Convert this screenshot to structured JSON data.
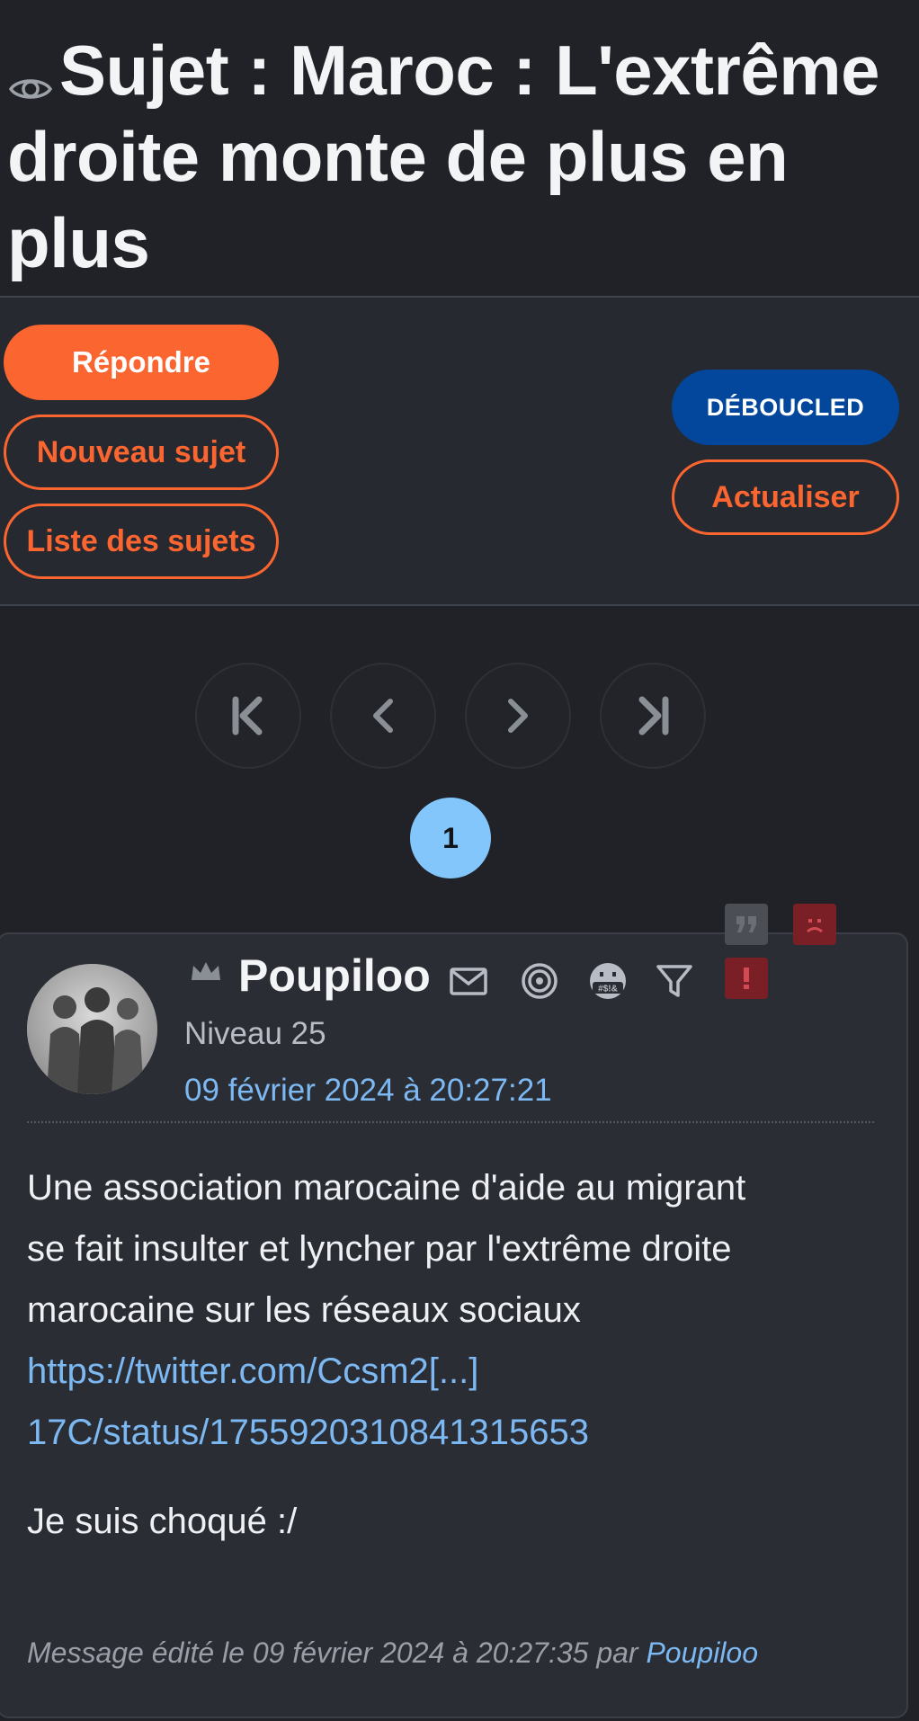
{
  "topic": {
    "title_line1": "Sujet : Maroc : L'extrême",
    "title_line2": "droite monte de plus en plus"
  },
  "actions": {
    "reply_label": "Répondre",
    "new_topic_label": "Nouveau sujet",
    "topic_list_label": "Liste des sujets",
    "deboucled_label": "DÉBOUCLED",
    "refresh_label": "Actualiser"
  },
  "pagination": {
    "current_page": "1",
    "icons": [
      "first-page-icon",
      "prev-page-icon",
      "next-page-icon",
      "last-page-icon"
    ]
  },
  "post": {
    "author": "Poupiloo",
    "level": "Niveau 25",
    "date": "09 février 2024 à 20:27:21",
    "body_lines": [
      "Une association marocaine d'aide au migrant",
      "se fait insulter et lyncher par l'extrême droite",
      "marocaine sur les réseaux sociaux"
    ],
    "link_line1": "https://twitter.com/Ccsm2[...]",
    "link_line2": "17C/status/1755920310841315653",
    "extra_text": "Je suis choqué :/",
    "edit_prefix": "Message édité le 09 février 2024 à 20:27:35 par ",
    "edit_user": "Poupiloo"
  },
  "colors": {
    "accent": "#fb6530",
    "blue_button": "#02479c",
    "link": "#7cb8f2",
    "current_page": "#83c6fc",
    "report": "#7a1f26"
  }
}
